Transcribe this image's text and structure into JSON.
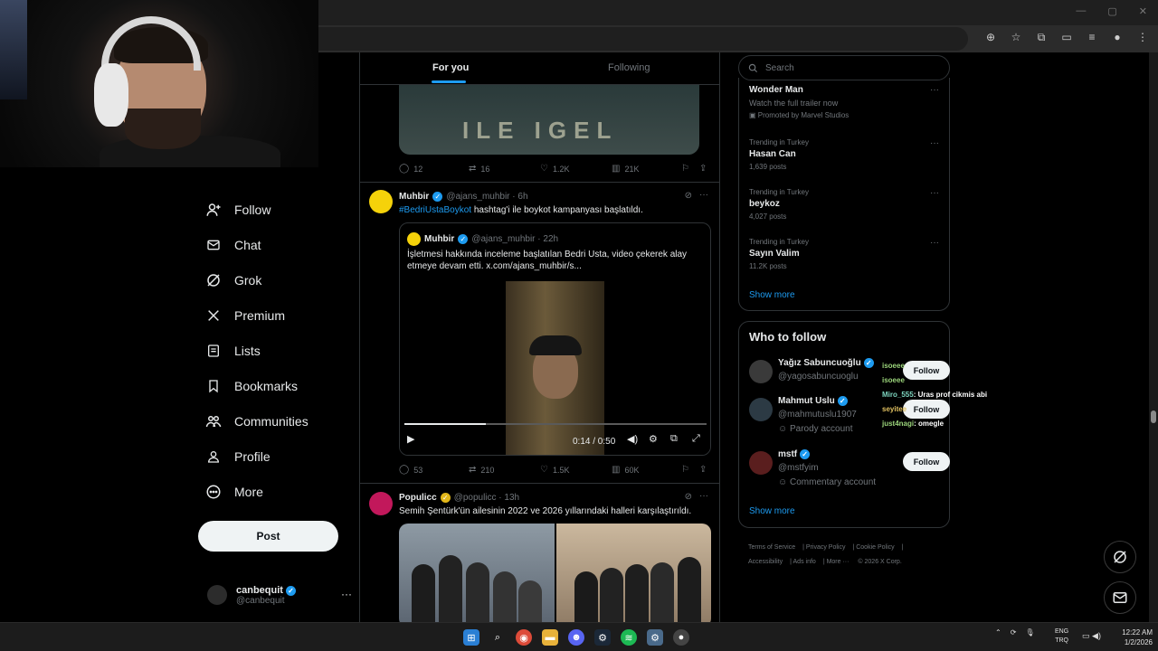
{
  "browser": {
    "window_controls": [
      "—",
      "▢",
      "✕"
    ]
  },
  "feed": {
    "tabs": [
      {
        "label": "For you"
      },
      {
        "label": "Following"
      }
    ],
    "top_post_media_text": "ILE IGEL",
    "top_post_stats": {
      "replies": "12",
      "reposts": "16",
      "likes": "1.2K",
      "views": "21K"
    },
    "post1": {
      "name": "Muhbir",
      "handle": "@ajans_muhbir · 6h",
      "hashtag": "#BedriUstaBoykot",
      "text": " hashtag'i ile boykot kampanyası başlatıldı.",
      "quote": {
        "name": "Muhbir",
        "handle": "@ajans_muhbir · 22h",
        "text": "İşletmesi hakkında inceleme başlatılan Bedri Usta, video çekerek alay etmeye devam etti.  x.com/ajans_muhbir/s...",
        "video_time": "0:14 / 0:50",
        "progress": 0.27
      },
      "stats": {
        "replies": "53",
        "reposts": "210",
        "likes": "1.5K",
        "views": "60K"
      }
    },
    "post2": {
      "name": "Populicc",
      "handle": "@populicc · 13h",
      "text": "Semih Şentürk'ün ailesinin 2022 ve 2026 yıllarındaki halleri karşılaştırıldı."
    }
  },
  "sidebar": {
    "items": [
      {
        "label": "Follow"
      },
      {
        "label": "Chat"
      },
      {
        "label": "Grok"
      },
      {
        "label": "Premium"
      },
      {
        "label": "Lists"
      },
      {
        "label": "Bookmarks"
      },
      {
        "label": "Communities"
      },
      {
        "label": "Profile"
      },
      {
        "label": "More"
      }
    ],
    "post_label": "Post",
    "account": {
      "name": "canbequit",
      "handle": "@canbequit"
    }
  },
  "right": {
    "search_placeholder": "Search",
    "promo": {
      "title": "Wonder Man",
      "subtitle": "Watch the full trailer now",
      "promoted": "Promoted by Marvel Studios"
    },
    "trends": [
      {
        "meta": "Trending in Turkey",
        "title": "Hasan Can",
        "posts": "1,639 posts"
      },
      {
        "meta": "Trending in Turkey",
        "title": "beykoz",
        "posts": "4,027 posts"
      },
      {
        "meta": "Trending in Turkey",
        "title": "Sayın Valim",
        "posts": "11.2K posts"
      }
    ],
    "show_more": "Show more",
    "who_to_follow": {
      "title": "Who to follow",
      "users": [
        {
          "name": "Yağız Sabuncuoğlu",
          "handle": "@yagosabuncuoglu",
          "label": "",
          "button": "Follow"
        },
        {
          "name": "Mahmut Uslu",
          "handle": "@mahmutuslu1907",
          "label": "Parody account",
          "button": "Follow"
        },
        {
          "name": "mstf",
          "handle": "@mstfyim",
          "label": "Commentary account",
          "button": "Follow"
        }
      ],
      "show_more": "Show more"
    },
    "footer": [
      "Terms of Service",
      "Privacy Policy",
      "Cookie Policy",
      "Accessibility",
      "Ads info",
      "More ···",
      "© 2026 X Corp."
    ]
  },
  "chat_overlay": [
    {
      "user": "isoeee",
      "msg": ""
    },
    {
      "user": "isoeee",
      "msg": ""
    },
    {
      "user": "Miro_555",
      "msg": ": Uras prof cikmis abi"
    },
    {
      "user": "seyitee",
      "msg": ""
    },
    {
      "user": "just4nagi",
      "msg": ": omegle"
    }
  ],
  "taskbar": {
    "lang": [
      "ENG",
      "TRQ"
    ],
    "time": "12:22 AM",
    "date": "1/2/2026"
  },
  "colors": {
    "accent": "#1d9bf0",
    "background": "#000000",
    "border": "#2f3336",
    "muted": "#71767b"
  }
}
